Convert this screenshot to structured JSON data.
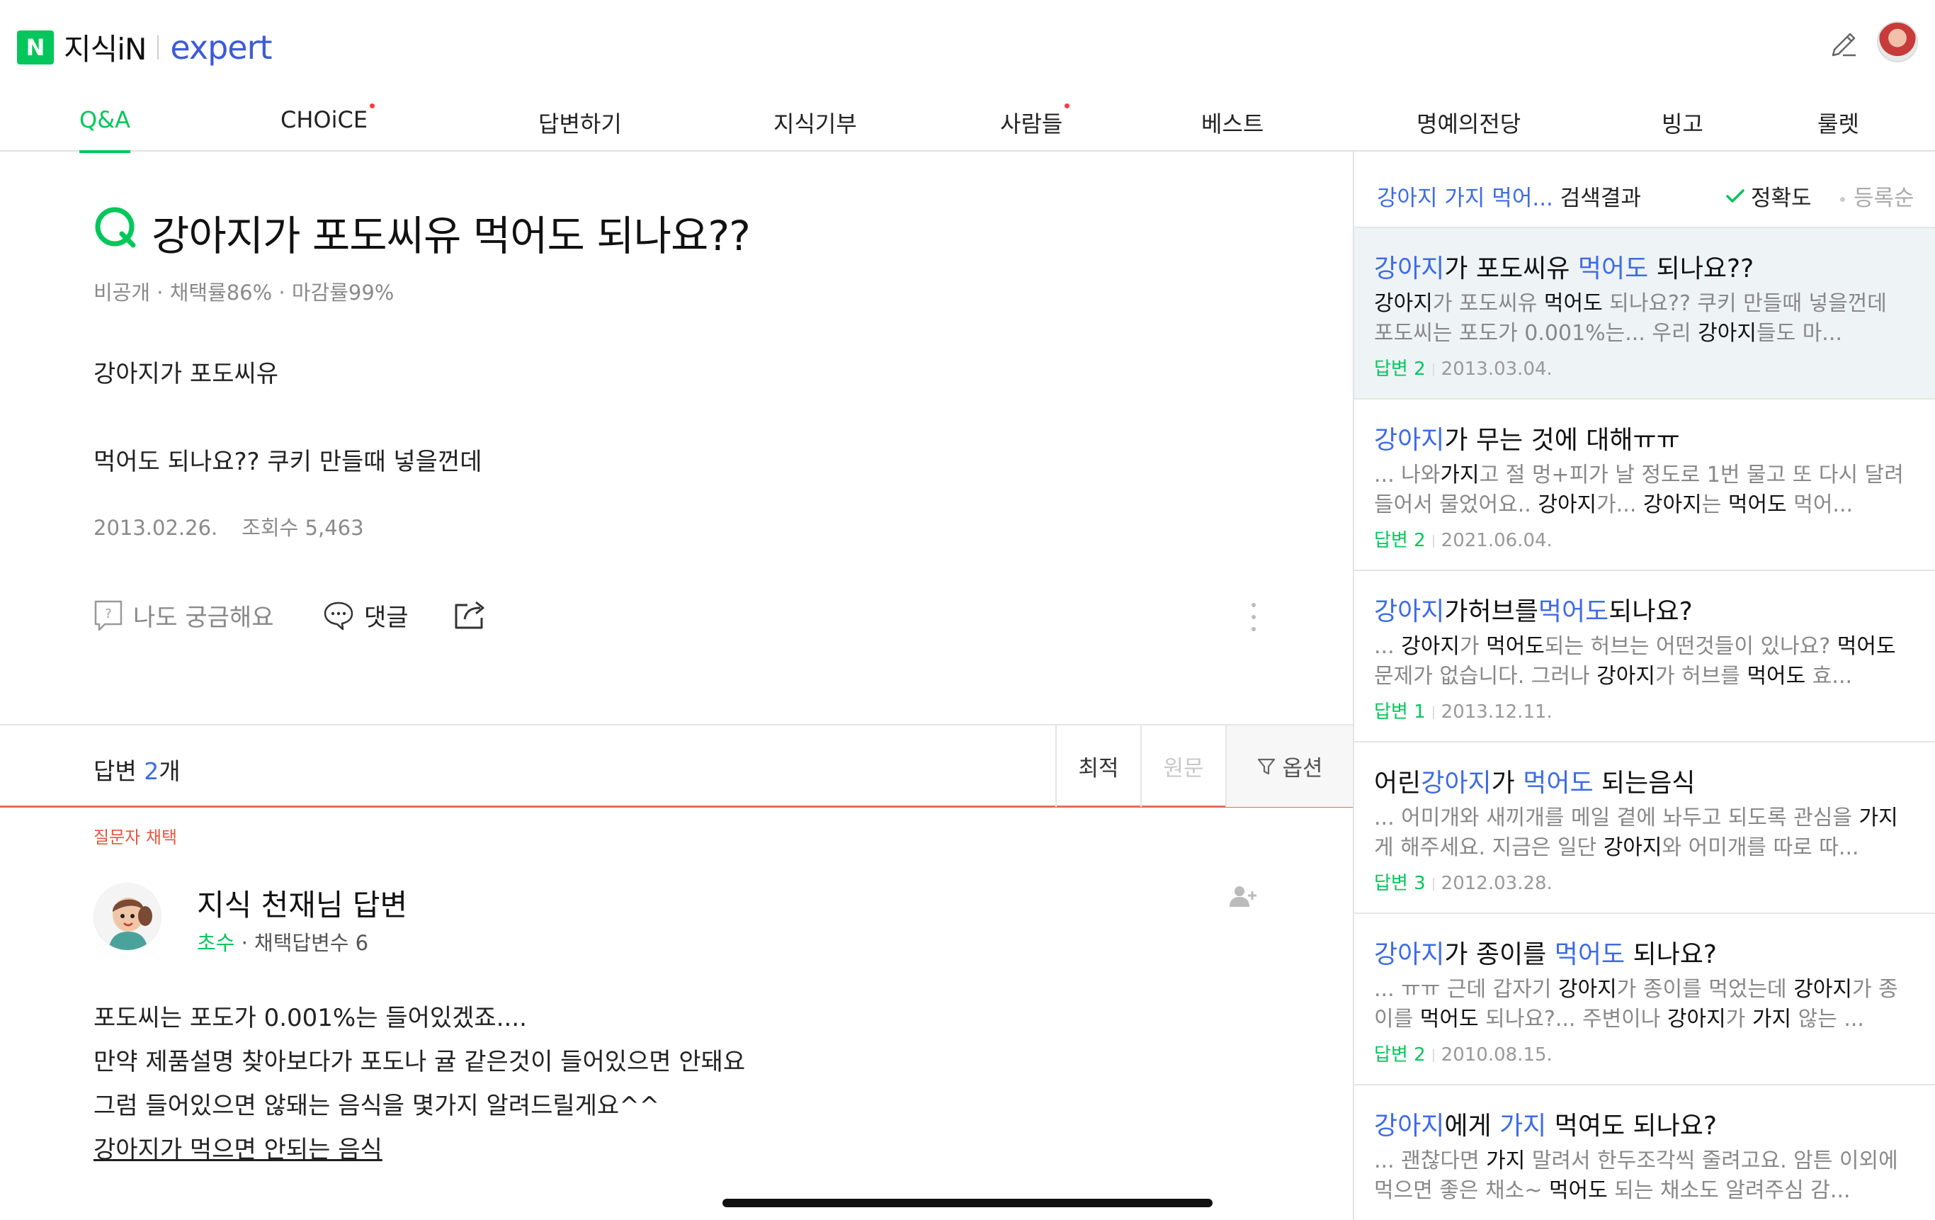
{
  "header": {
    "logo_n": "N",
    "brand": "지식iN",
    "expert": "expert"
  },
  "nav": [
    {
      "label": "Q&A",
      "active": true
    },
    {
      "label": "CHOiCE",
      "dot": true
    },
    {
      "label": "답변하기"
    },
    {
      "label": "지식기부"
    },
    {
      "label": "사람들",
      "dot": true
    },
    {
      "label": "베스트"
    },
    {
      "label": "명예의전당"
    },
    {
      "label": "빙고"
    },
    {
      "label": "룰렛"
    }
  ],
  "question": {
    "title": "강아지가 포도씨유 먹어도 되나요??",
    "meta": "비공개 · 채택률86% · 마감률99%",
    "body_line1": "강아지가 포도씨유",
    "body_line2": "먹어도 되나요?? 쿠키 만들때 넣을껀데",
    "date": "2013.02.26.",
    "views": "조회수 5,463",
    "curious_label": "나도 궁금해요",
    "comment_label": "댓글"
  },
  "answers_bar": {
    "label_prefix": "답변 ",
    "count": "2",
    "label_suffix": "개",
    "sort_best": "최적",
    "sort_original": "원문",
    "options": "옵션"
  },
  "answer": {
    "chosen_badge": "질문자 채택",
    "name": "지식 천재님 답변",
    "grade": "초수",
    "meta_rest": " · 채택답변수 6",
    "lines": [
      " 포도씨는 포도가 0.001%는 들어있겠죠....",
      "만약 제품설명 찾아보다가 포도나 귤 같은것이 들어있으면 안돼요",
      "그럼 들어있으면 않돼는 음식을 몇가지 알려드릴게요^^"
    ],
    "link_text": "강아지가 먹으면 안되는 음식"
  },
  "sidebar": {
    "query_kw": "강아지 가지 먹어...",
    "query_suffix": " 검색결과",
    "sort_accuracy": "정확도",
    "sort_date": "등록순"
  },
  "results": [
    {
      "title_html": "<span class=\"hl\">강아지</span>가 포도씨유 <span class=\"hl\">먹어도</span> 되나요??",
      "snippet_html": "<b>강아지</b>가 포도씨유 <b>먹어도</b> 되나요?? 쿠키 만들때 넣을껀데 포도씨는 포도가 0.001%는... 우리 <b>강아지</b>들도 마...",
      "answers": "답변 2",
      "date": "2013.03.04."
    },
    {
      "title_html": "<span class=\"hl\">강아지</span>가 무는 것에 대해ㅠㅠ",
      "snippet_html": "... 나와<b>가지</b>고 절 멍+피가 날 정도로 1번 물고 또 다시 달려들어서 물었어요.. <b>강아지</b>가... <b>강아지</b>는 <b>먹어도</b> 먹어...",
      "answers": "답변 2",
      "date": "2021.06.04."
    },
    {
      "title_html": "<span class=\"hl\">강아지</span>가허브를<span class=\"hl\">먹어도</span>되나요?",
      "snippet_html": "... <b>강아지</b>가 <b>먹어도</b>되는 허브는 어떤것들이 있나요? <b>먹어도</b> 문제가 없습니다. 그러나 <b>강아지</b>가 허브를 <b>먹어도</b> 효...",
      "answers": "답변 1",
      "date": "2013.12.11."
    },
    {
      "title_html": "어린<span class=\"hl\">강아지</span>가 <span class=\"hl\">먹어도</span> 되는음식",
      "snippet_html": "... 어미개와 새끼개를 메일 곁에 놔두고 되도록 관심을 <b>가지</b>게 해주세요. 지금은 일단 <b>강아지</b>와 어미개를 따로 따...",
      "answers": "답변 3",
      "date": "2012.03.28."
    },
    {
      "title_html": "<span class=\"hl\">강아지</span>가 종이를 <span class=\"hl\">먹어도</span> 되나요?",
      "snippet_html": "... ㅠㅠ 근데 갑자기 <b>강아지</b>가 종이를 먹었는데 <b>강아지</b>가 종이를 <b>먹어도</b> 되나요?... 주변이나 <b>강아지</b>가 <b>가지</b> 않는 ...",
      "answers": "답변 2",
      "date": "2010.08.15."
    },
    {
      "title_html": "<span class=\"hl\">강아지</span>에게 <span class=\"hl\">가지</span> 먹여도 되나요?",
      "snippet_html": "... 괜찮다면 <b>가지</b> 말려서 한두조각씩 줄려고요. 암튼 이외에 먹으면 좋은 채소~ <b>먹어도</b> 되는 채소도 알려주심 감...",
      "answers": "",
      "date": ""
    }
  ],
  "colors": {
    "naver_green": "#03c75a",
    "expert_blue": "#3d5bd9",
    "highlight_blue": "#3d6be6",
    "chosen_red": "#e8553f"
  }
}
